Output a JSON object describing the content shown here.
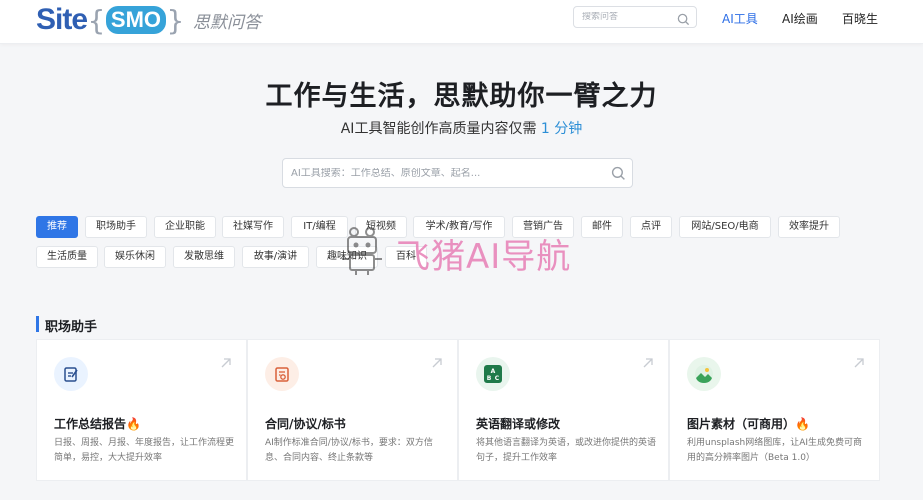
{
  "brand": {
    "site": "Site",
    "smo": "SMO",
    "brace_left": "{",
    "brace_right": "}",
    "cn_name": "思默问答"
  },
  "header": {
    "search_placeholder": "搜索问答",
    "nav": [
      {
        "label": "AI工具",
        "active": true
      },
      {
        "label": "AI绘画",
        "active": false
      },
      {
        "label": "百晓生",
        "active": false
      }
    ]
  },
  "hero": {
    "title": "工作与生活，思默助你一臂之力",
    "subtitle_prefix": "AI工具智能创作高质量内容仅需",
    "subtitle_accent": "1 分钟",
    "search_placeholder": "AI工具搜索：工作总结、原创文章、起名..."
  },
  "tags": [
    "推荐",
    "职场助手",
    "企业职能",
    "社媒写作",
    "IT/编程",
    "短视频",
    "学术/教育/写作",
    "营销广告",
    "邮件",
    "点评",
    "网站/SEO/电商",
    "效率提升",
    "生活质量",
    "娱乐休闲",
    "发散思维",
    "故事/演讲",
    "趣味知识",
    "百科"
  ],
  "watermark": {
    "text": "飞猪AI导航"
  },
  "section": {
    "title": "职场助手"
  },
  "cards": [
    {
      "title": "工作总结报告",
      "fire": "🔥",
      "desc": "日报、周报、月报、年度报告，让工作流程更简单，易控，大大提升效率",
      "icon": "edit-doc-icon"
    },
    {
      "title": "合同/协议/标书",
      "fire": "",
      "desc": "AI制作标准合同/协议/标书，要求：双方信息、合同内容、终止条款等",
      "icon": "contract-icon"
    },
    {
      "title": "英语翻译或修改",
      "fire": "",
      "desc": "将其他语言翻译为英语，或改进你提供的英语句子，提升工作效率",
      "icon": "abc-translate-icon"
    },
    {
      "title": "图片素材（可商用）",
      "fire": "🔥",
      "desc": "利用unsplash网络图库，让AI生成免费可商用的高分辨率图片（Beta 1.0）",
      "icon": "image-icon"
    }
  ],
  "colors": {
    "accent": "#2f76e6",
    "card_icon_bg_1": "#eaf3ff",
    "card_icon_bg_2": "#fdeee6",
    "card_icon_bg_3": "#e9f5ee",
    "card_icon_bg_4": "#e9f6ec"
  }
}
